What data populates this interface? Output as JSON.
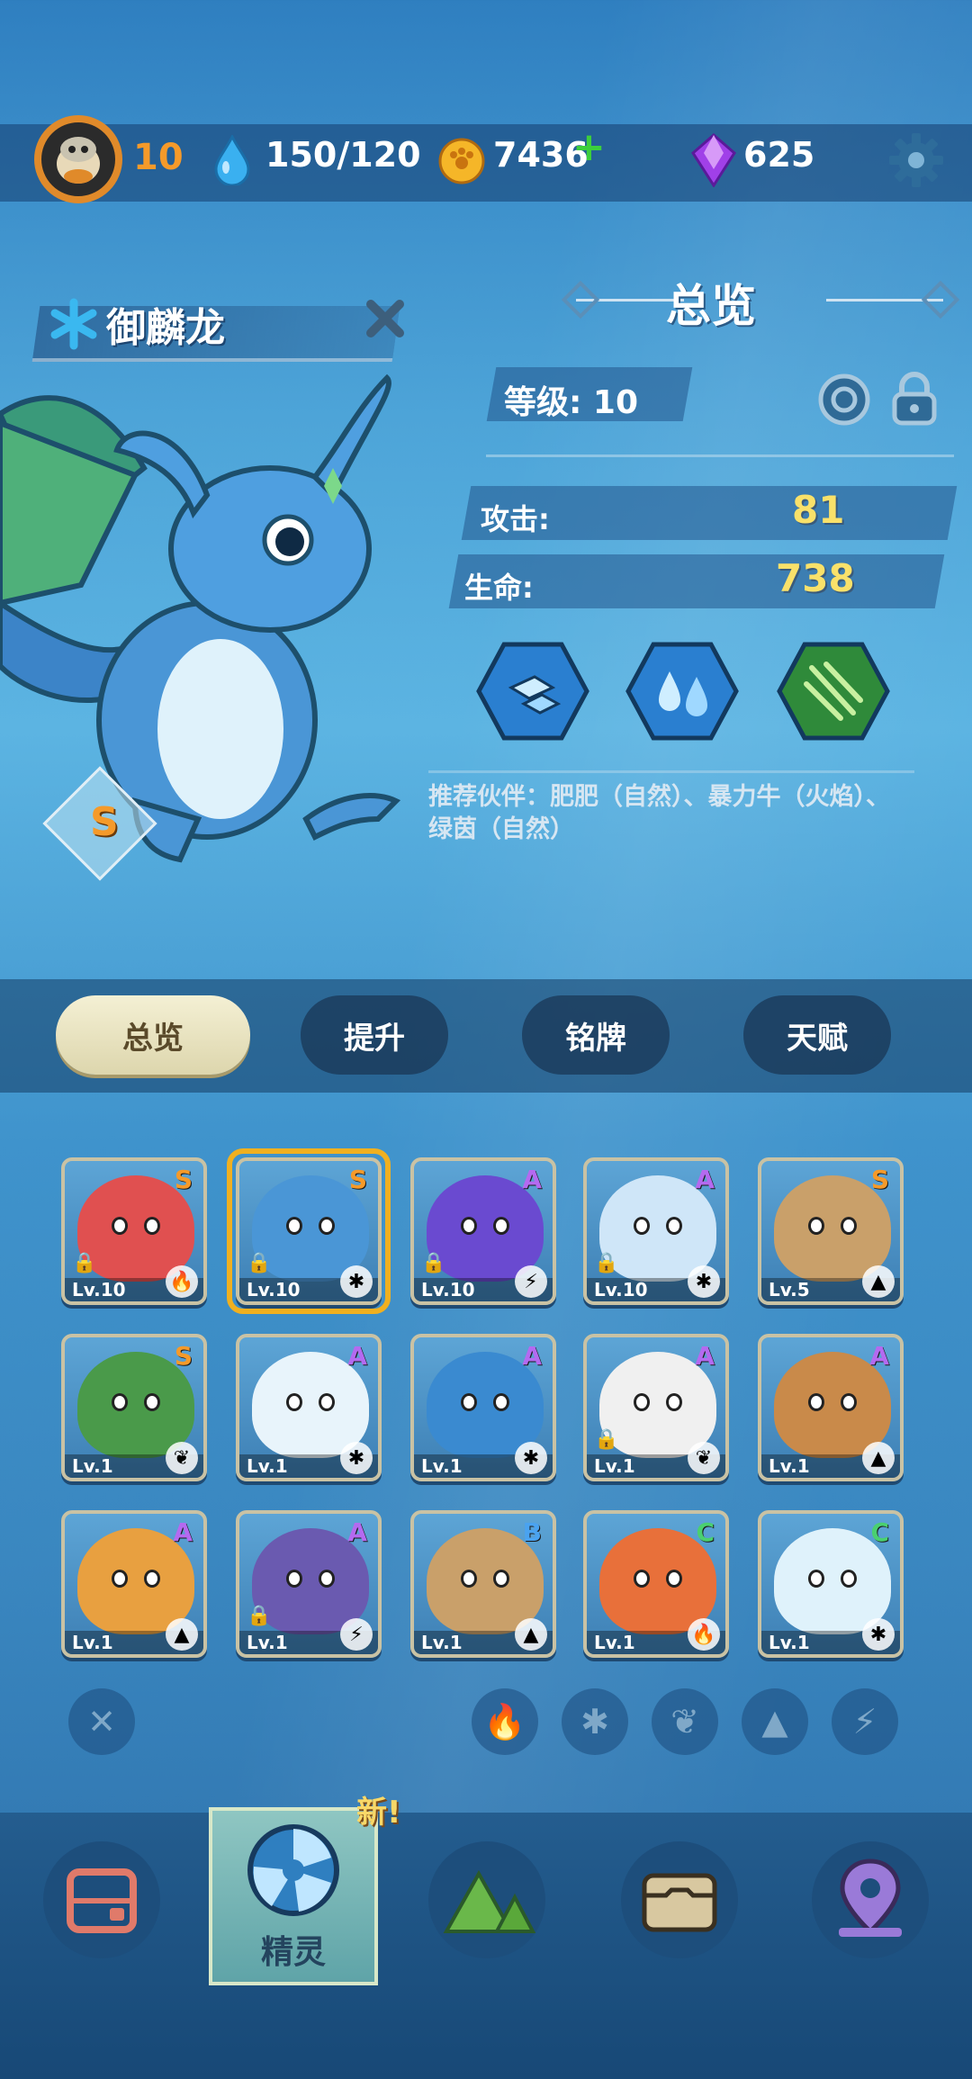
{
  "topbar": {
    "level": "10",
    "energy": "150/120",
    "coins": "7436",
    "gems": "625"
  },
  "creature": {
    "name": "御麟龙",
    "grade": "S"
  },
  "overview": {
    "title": "总览",
    "level_label": "等级: 10",
    "attack_label": "攻击:",
    "attack_value": "81",
    "hp_label": "生命:",
    "hp_value": "738",
    "partner_text": "推荐伙伴：肥肥（自然）、暴力牛（火焰）、绿茵（自然）"
  },
  "tabs": [
    {
      "label": "总览"
    },
    {
      "label": "提升"
    },
    {
      "label": "铭牌"
    },
    {
      "label": "天赋"
    }
  ],
  "cards": [
    {
      "grade": "S",
      "level": "Lv.10",
      "element": "fire",
      "elem_glyph": "🔥",
      "locked": true
    },
    {
      "grade": "S",
      "level": "Lv.10",
      "element": "ice",
      "elem_glyph": "✱",
      "locked": true,
      "selected": true
    },
    {
      "grade": "A",
      "level": "Lv.10",
      "element": "lightning",
      "elem_glyph": "⚡",
      "locked": true
    },
    {
      "grade": "A",
      "level": "Lv.10",
      "element": "ice",
      "elem_glyph": "✱",
      "locked": true
    },
    {
      "grade": "S",
      "level": "Lv.5",
      "element": "rock",
      "elem_glyph": "▲",
      "locked": false
    },
    {
      "grade": "S",
      "level": "Lv.1",
      "element": "nature",
      "elem_glyph": "❦",
      "locked": false
    },
    {
      "grade": "A",
      "level": "Lv.1",
      "element": "ice",
      "elem_glyph": "✱",
      "locked": false
    },
    {
      "grade": "A",
      "level": "Lv.1",
      "element": "ice",
      "elem_glyph": "✱",
      "locked": false
    },
    {
      "grade": "A",
      "level": "Lv.1",
      "element": "nature",
      "elem_glyph": "❦",
      "locked": true
    },
    {
      "grade": "A",
      "level": "Lv.1",
      "element": "rock",
      "elem_glyph": "▲",
      "locked": false
    },
    {
      "grade": "A",
      "level": "Lv.1",
      "element": "rock",
      "elem_glyph": "▲",
      "locked": false
    },
    {
      "grade": "A",
      "level": "Lv.1",
      "element": "lightning",
      "elem_glyph": "⚡",
      "locked": true
    },
    {
      "grade": "B",
      "level": "Lv.1",
      "element": "rock",
      "elem_glyph": "▲",
      "locked": false
    },
    {
      "grade": "C",
      "level": "Lv.1",
      "element": "fire",
      "elem_glyph": "🔥",
      "locked": false
    },
    {
      "grade": "C",
      "level": "Lv.1",
      "element": "ice",
      "elem_glyph": "✱",
      "locked": false
    }
  ],
  "filters": [
    {
      "icon": "fire-icon",
      "glyph": "🔥"
    },
    {
      "icon": "ice-icon",
      "glyph": "✱"
    },
    {
      "icon": "leaf-icon",
      "glyph": "❦"
    },
    {
      "icon": "rock-icon",
      "glyph": "▲"
    },
    {
      "icon": "lightning-icon",
      "glyph": "⚡"
    }
  ],
  "bottom_nav": {
    "active_label": "精灵",
    "new_badge": "新!"
  },
  "colors": {
    "grade_S": "#f59a2a",
    "grade_A": "#b46af0",
    "grade_B": "#4aa3f0",
    "grade_C": "#4ad070",
    "stat_value": "#f9e16a"
  }
}
